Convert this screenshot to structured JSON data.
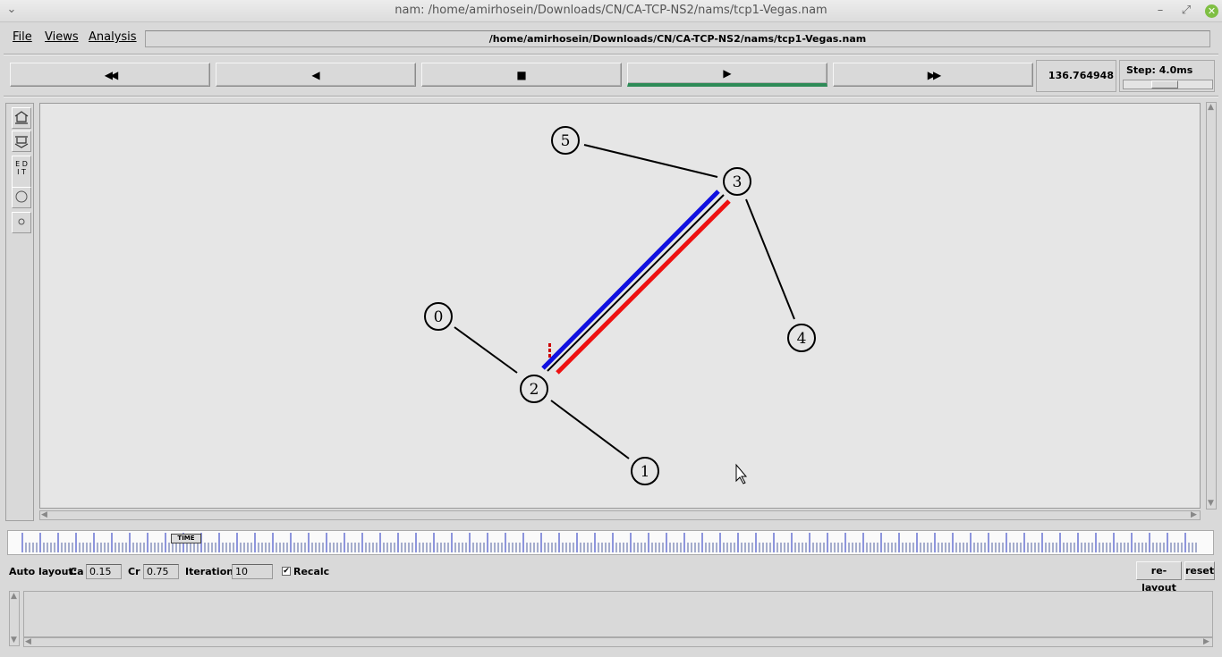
{
  "window": {
    "title": "nam: /home/amirhosein/Downloads/CN/CA-TCP-NS2/nams/tcp1-Vegas.nam",
    "controls": [
      "minimize-icon",
      "restore-icon",
      "close-icon"
    ]
  },
  "menu": {
    "file": "File",
    "views": "Views",
    "analysis": "Analysis",
    "path": "/home/amirhosein/Downloads/CN/CA-TCP-NS2/nams/tcp1-Vegas.nam"
  },
  "transport": {
    "rewind": "◀◀",
    "back": "◀",
    "stop": "■",
    "play": "▶",
    "fastforward": "▶▶",
    "time": "136.764948",
    "step_label": "Step: 4.0ms",
    "step_slider_level": 0.45,
    "play_active_color": "#2e8b57"
  },
  "toolbar": {
    "zoom_in": "zoom-in-icon",
    "zoom_out": "zoom-out-icon",
    "edit": "EDIT",
    "edit_line1": "E D",
    "edit_line2": "I T",
    "node_large": "circle-icon",
    "node_small": "small-circle-icon"
  },
  "network": {
    "nodes": [
      {
        "id": "0",
        "label": "0"
      },
      {
        "id": "1",
        "label": "1"
      },
      {
        "id": "2",
        "label": "2"
      },
      {
        "id": "3",
        "label": "3"
      },
      {
        "id": "4",
        "label": "4"
      },
      {
        "id": "5",
        "label": "5"
      }
    ],
    "links": [
      [
        "0",
        "2"
      ],
      [
        "1",
        "2"
      ],
      [
        "2",
        "3"
      ],
      [
        "5",
        "3"
      ],
      [
        "3",
        "4"
      ]
    ],
    "flow_colors": {
      "forward": "#1010e0",
      "reverse": "#ee1111",
      "queue": "#cc0000"
    }
  },
  "timeline": {
    "marker": "TIME"
  },
  "autolayout": {
    "label": "Auto layout:",
    "ca_label": "Ca",
    "ca_value": "0.15",
    "cr_label": "Cr",
    "cr_value": "0.75",
    "iterations_label": "Iterations",
    "iterations_value": "10",
    "recalc_label": "Recalc",
    "recalc_checked": true,
    "relayout": "re-layout",
    "reset": "reset"
  }
}
